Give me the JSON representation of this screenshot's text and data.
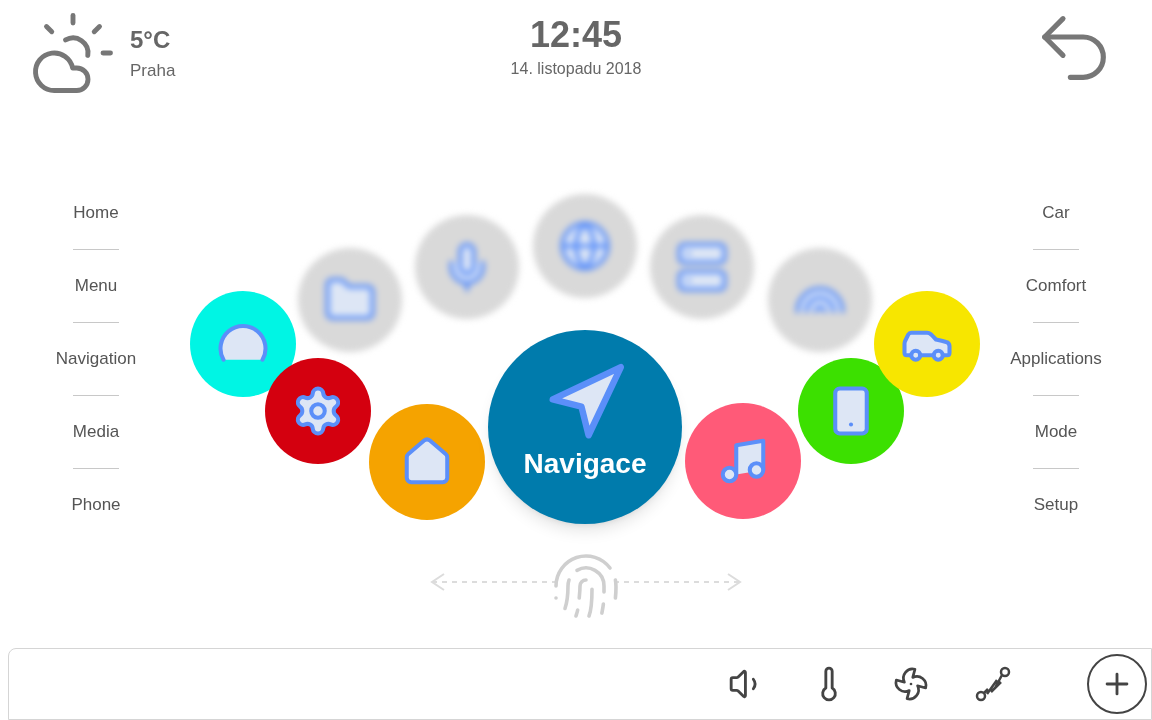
{
  "weather": {
    "temperature": "5°C",
    "city": "Praha"
  },
  "clock": {
    "time": "12:45",
    "date": "14. listopadu 2018"
  },
  "left_menu": [
    "Home",
    "Menu",
    "Navigation",
    "Media",
    "Phone"
  ],
  "right_menu": [
    "Car",
    "Comfort",
    "Applications",
    "Mode",
    "Setup"
  ],
  "carousel": [
    {
      "kind": "faded",
      "color": "#d9d9d9",
      "selected": false
    },
    {
      "kind": "faded",
      "color": "#d9d9d9",
      "selected": false
    },
    {
      "kind": "faded",
      "color": "#d9d9d9",
      "selected": false
    },
    {
      "kind": "faded",
      "color": "#d9d9d9",
      "selected": false
    },
    {
      "kind": "faded",
      "color": "#d9d9d9",
      "selected": false
    },
    {
      "kind": "item",
      "color": "#00f5e4",
      "selected": false
    },
    {
      "kind": "item",
      "color": "#d4000f",
      "selected": false
    },
    {
      "kind": "item",
      "color": "#f5a300",
      "selected": false
    },
    {
      "kind": "item",
      "color": "#007bac",
      "selected": true,
      "label": "Navigace"
    },
    {
      "kind": "item",
      "color": "#ff5a78",
      "selected": false
    },
    {
      "kind": "item",
      "color": "#3ce000",
      "selected": false
    },
    {
      "kind": "item",
      "color": "#f7e600",
      "selected": false
    }
  ]
}
